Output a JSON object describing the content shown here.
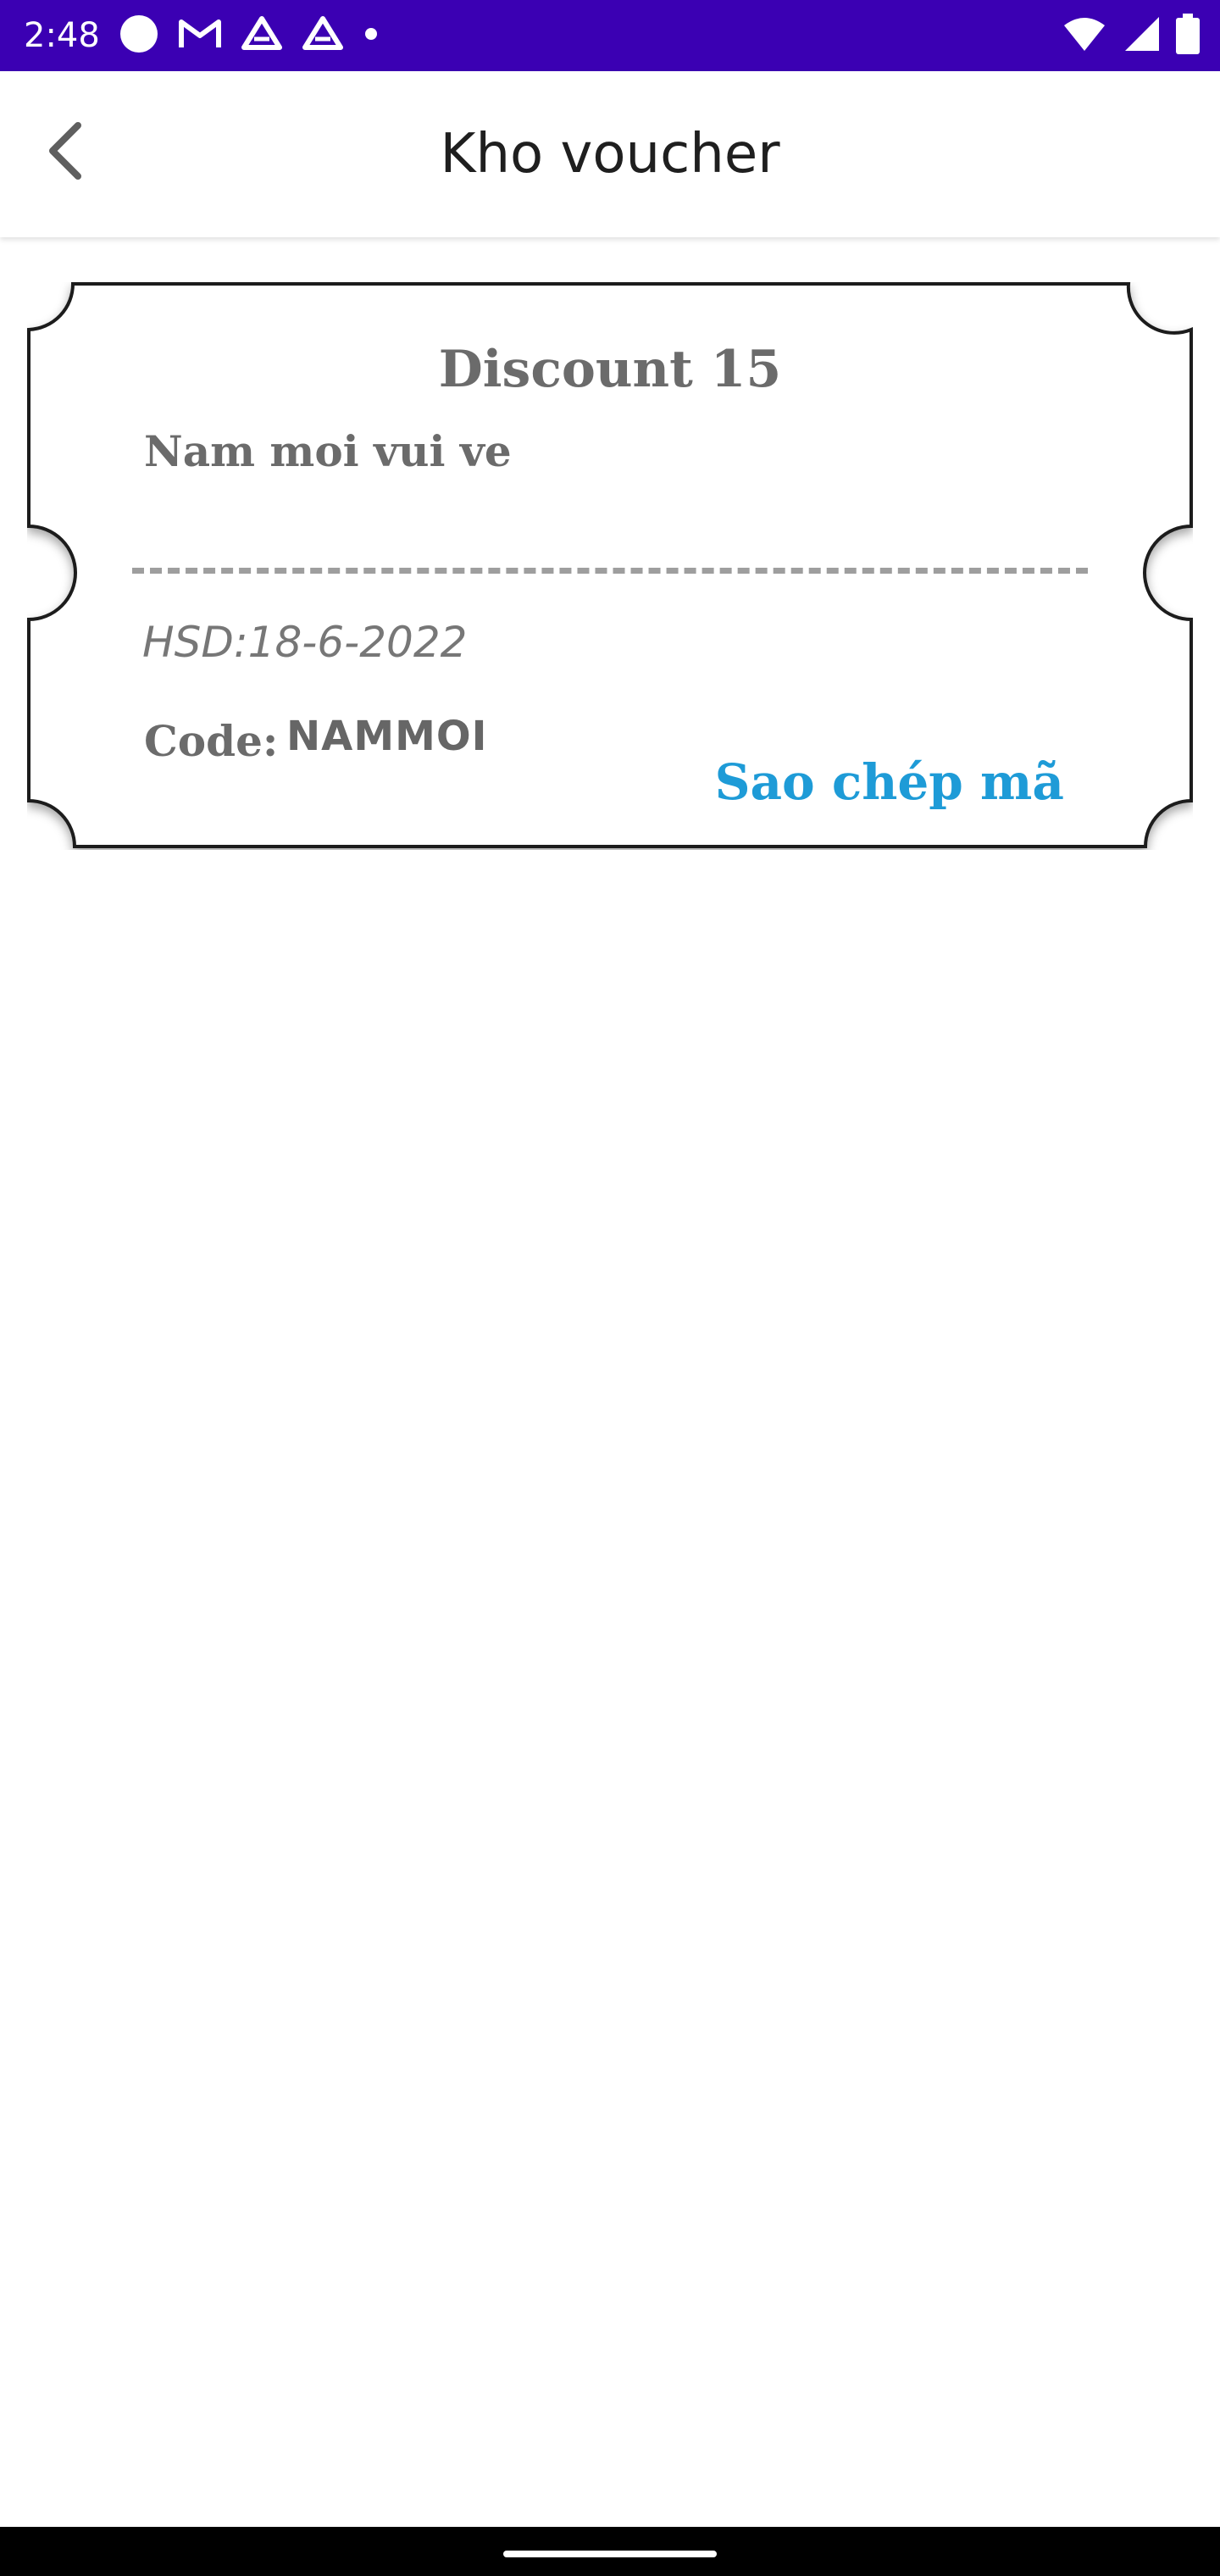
{
  "status_bar": {
    "time": "2:48",
    "background_color": "#3b00b3",
    "left_icons": [
      "circle-icon",
      "gmail-icon",
      "drive-icon",
      "drive-icon",
      "dot-icon"
    ],
    "right_icons": [
      "wifi-icon",
      "signal-icon",
      "battery-icon"
    ]
  },
  "app_bar": {
    "title": "Kho voucher",
    "back_icon": "chevron-left-icon"
  },
  "voucher": {
    "title": "Discount 15",
    "subtitle": "Nam moi vui ve",
    "expiry": "HSD:18-6-2022",
    "code_label": "Code:",
    "code_value": "NAMMOI",
    "copy_label": "Sao chép mã",
    "accent_color": "#1e9bd7"
  }
}
